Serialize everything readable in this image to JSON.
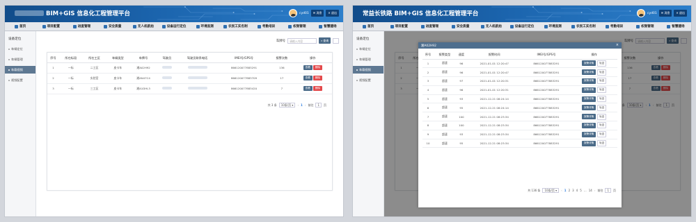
{
  "app": {
    "title": "BIM+GIS 信息化工程管理平台",
    "title_prefix": "常益长铁路",
    "username": "cyd01",
    "btn_msg": "消息",
    "btn_exit": "退出"
  },
  "nav": [
    "首页",
    "项目配置",
    "进度管理",
    "安全质量",
    "无人机航拍",
    "设备运行定位",
    "环境监测",
    "农民工实名制",
    "考勤培训",
    "权限管理",
    "智慧建场"
  ],
  "sidebar": {
    "head": "设备定位",
    "items": [
      "车辆定位",
      "车辆管理",
      "车载视频",
      "视频配置"
    ],
    "active": 2
  },
  "search": {
    "label": "车牌号",
    "placeholder": "请输入内容",
    "btn": "查询"
  },
  "table": {
    "headers": [
      "序号",
      "所在标段",
      "所在工区",
      "车辆类型",
      "车牌号",
      "驾驶员",
      "驾驶员联系电话",
      "IMEI号/GPS号",
      "报警次数",
      "操作"
    ],
    "rows": [
      [
        "1",
        "一标",
        "二工区",
        "皮卡车",
        "湘A02H92",
        "",
        "",
        "866120077883291",
        "136"
      ],
      [
        "2",
        "一标",
        "实验室",
        "皮卡车",
        "湘AN47C4",
        "",
        "",
        "866120077883709",
        "17"
      ],
      [
        "3",
        "一标",
        "三工区",
        "皮卡车",
        "湘A1DHL3",
        "",
        "",
        "866120077883420",
        "7"
      ]
    ],
    "btn_view": "查看",
    "btn_del": "删除"
  },
  "pagination1": {
    "total": "共 3 条",
    "size": "10条/页",
    "pages": [
      "1"
    ],
    "current": "1",
    "goto": "前往",
    "goto_val": "1",
    "page_unit": "页"
  },
  "modal": {
    "title": "湘A02H92",
    "headers": [
      "序号",
      "报警类型",
      "速度",
      "报警时间",
      "IMEI号/GPS号",
      "操作"
    ],
    "rows": [
      [
        "1",
        "超速",
        "96",
        "2021-01-01 12:20:47",
        "866120077883291"
      ],
      [
        "2",
        "超速",
        "96",
        "2021-01-01 12:20:47",
        "866120077883291"
      ],
      [
        "3",
        "超速",
        "97",
        "2021-01-01 12:20:31",
        "866120077883291"
      ],
      [
        "4",
        "超速",
        "96",
        "2021-01-01 12:20:31",
        "866120077883291"
      ],
      [
        "5",
        "超速",
        "93",
        "2021-12-21 08:24:14",
        "866120077883291"
      ],
      [
        "6",
        "超速",
        "95",
        "2021-12-21 08:24:14",
        "866120077883291"
      ],
      [
        "7",
        "超速",
        "100",
        "2021-12-21 08:23:34",
        "866120077883291"
      ],
      [
        "8",
        "超速",
        "100",
        "2021-12-21 08:23:34",
        "866120077883291"
      ],
      [
        "9",
        "超速",
        "93",
        "2021-12-21 08:23:34",
        "866120077883291"
      ],
      [
        "10",
        "超速",
        "95",
        "2021-12-21 08:23:34",
        "866120077883291"
      ]
    ],
    "btn_detail": "报警详情",
    "btn_track": "轨迹"
  },
  "pagination2": {
    "total": "共 136 条",
    "size": "10条/页",
    "pages": [
      "1",
      "2",
      "3",
      "4",
      "5",
      "…",
      "14"
    ],
    "current": "1",
    "goto": "前往",
    "goto_val": "1",
    "page_unit": "页"
  }
}
